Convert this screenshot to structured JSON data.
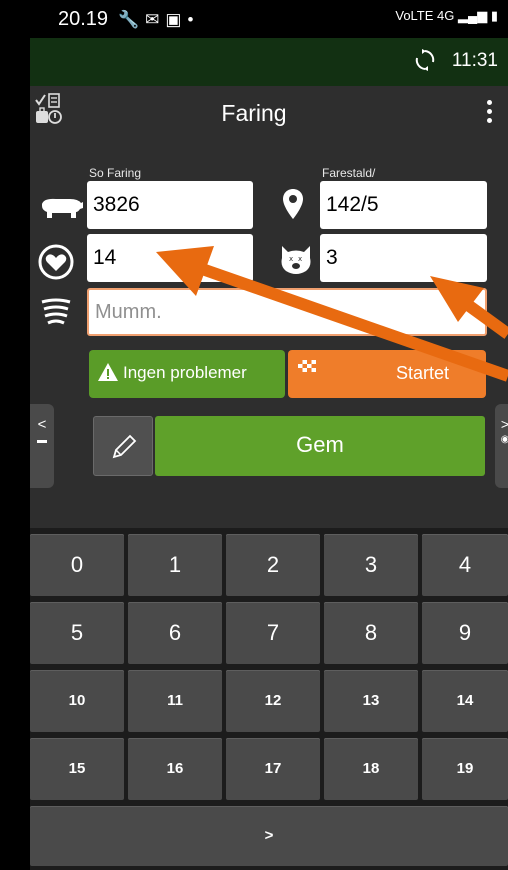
{
  "status_bar": {
    "time": "20.19",
    "notification_icons": [
      "wrench-icon",
      "gmail-icon",
      "outlook-icon",
      "dot-icon"
    ],
    "network": "VoLTE 4G"
  },
  "sync": {
    "time": "11:31",
    "icon": "sync-icon"
  },
  "header": {
    "title": "Faring",
    "left_icon": "toolbox-icon",
    "menu_icon": "overflow-menu-icon"
  },
  "form": {
    "sow_label": "So Faring",
    "sow_value": "3826",
    "pen_label": "Farestald/",
    "pen_value": "142/5",
    "liveborn_value": "14",
    "stillborn_value": "3",
    "mummy_placeholder": "Mumm."
  },
  "buttons": {
    "problems_label": "Ingen problemer",
    "started_label": "Startet",
    "save_label": "Gem"
  },
  "side_tabs": {
    "left": "<",
    "right": ">"
  },
  "keyboard": {
    "row1": [
      "0",
      "1",
      "2",
      "3",
      "4"
    ],
    "row2": [
      "5",
      "6",
      "7",
      "8",
      "9"
    ],
    "row3": [
      "10",
      "11",
      "12",
      "13",
      "14"
    ],
    "row4": [
      "15",
      "16",
      "17",
      "18",
      "19"
    ],
    "next_label": ">"
  },
  "colors": {
    "accent_green": "#5fa12a",
    "accent_orange": "#ef7d2a",
    "arrow_orange": "#e86a10"
  }
}
